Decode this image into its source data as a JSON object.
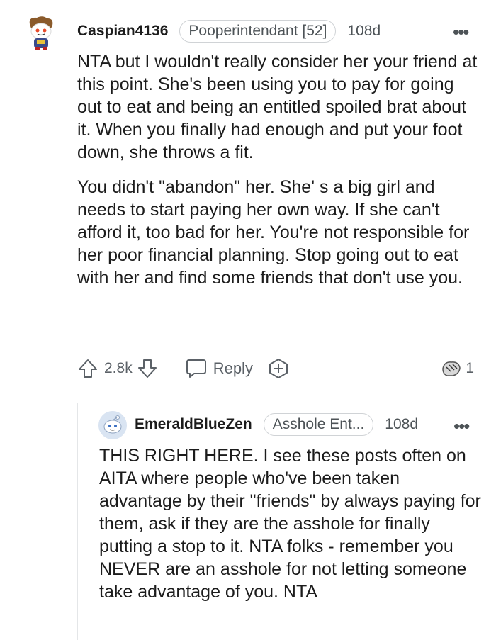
{
  "comment": {
    "username": "Caspian4136",
    "flair": "Pooperintendant [52]",
    "age": "108d",
    "paragraphs": [
      "NTA but I wouldn't really consider her your friend at this point. She's been using you to pay for going out to eat and being an entitled spoiled brat about it. When you finally had enough and put your foot down, she throws a fit.",
      "You didn't \"abandon\" her. She' s a big girl and needs to start paying her own way. If she can't afford it, too bad for her. You're not responsible for her poor financial planning. Stop going out to eat with her and find some friends that don't use you."
    ],
    "votes": "2.8k",
    "reply_label": "Reply",
    "award_count": "1",
    "more_icon": "more-options-icon",
    "colors": {
      "text": "#1c1c1c",
      "muted": "#4d5357",
      "line": "#e4e6e8"
    }
  },
  "reply": {
    "username": "EmeraldBlueZen",
    "flair": "Asshole Ent...",
    "age": "108d",
    "paragraphs": [
      "THIS RIGHT HERE. I see these posts often on AITA where people who've been taken advantage by their \"friends\" by always paying for them, ask if they are the asshole for finally putting a stop to it. NTA folks - remember you NEVER are an asshole for not letting someone take advantage of you. NTA"
    ]
  }
}
